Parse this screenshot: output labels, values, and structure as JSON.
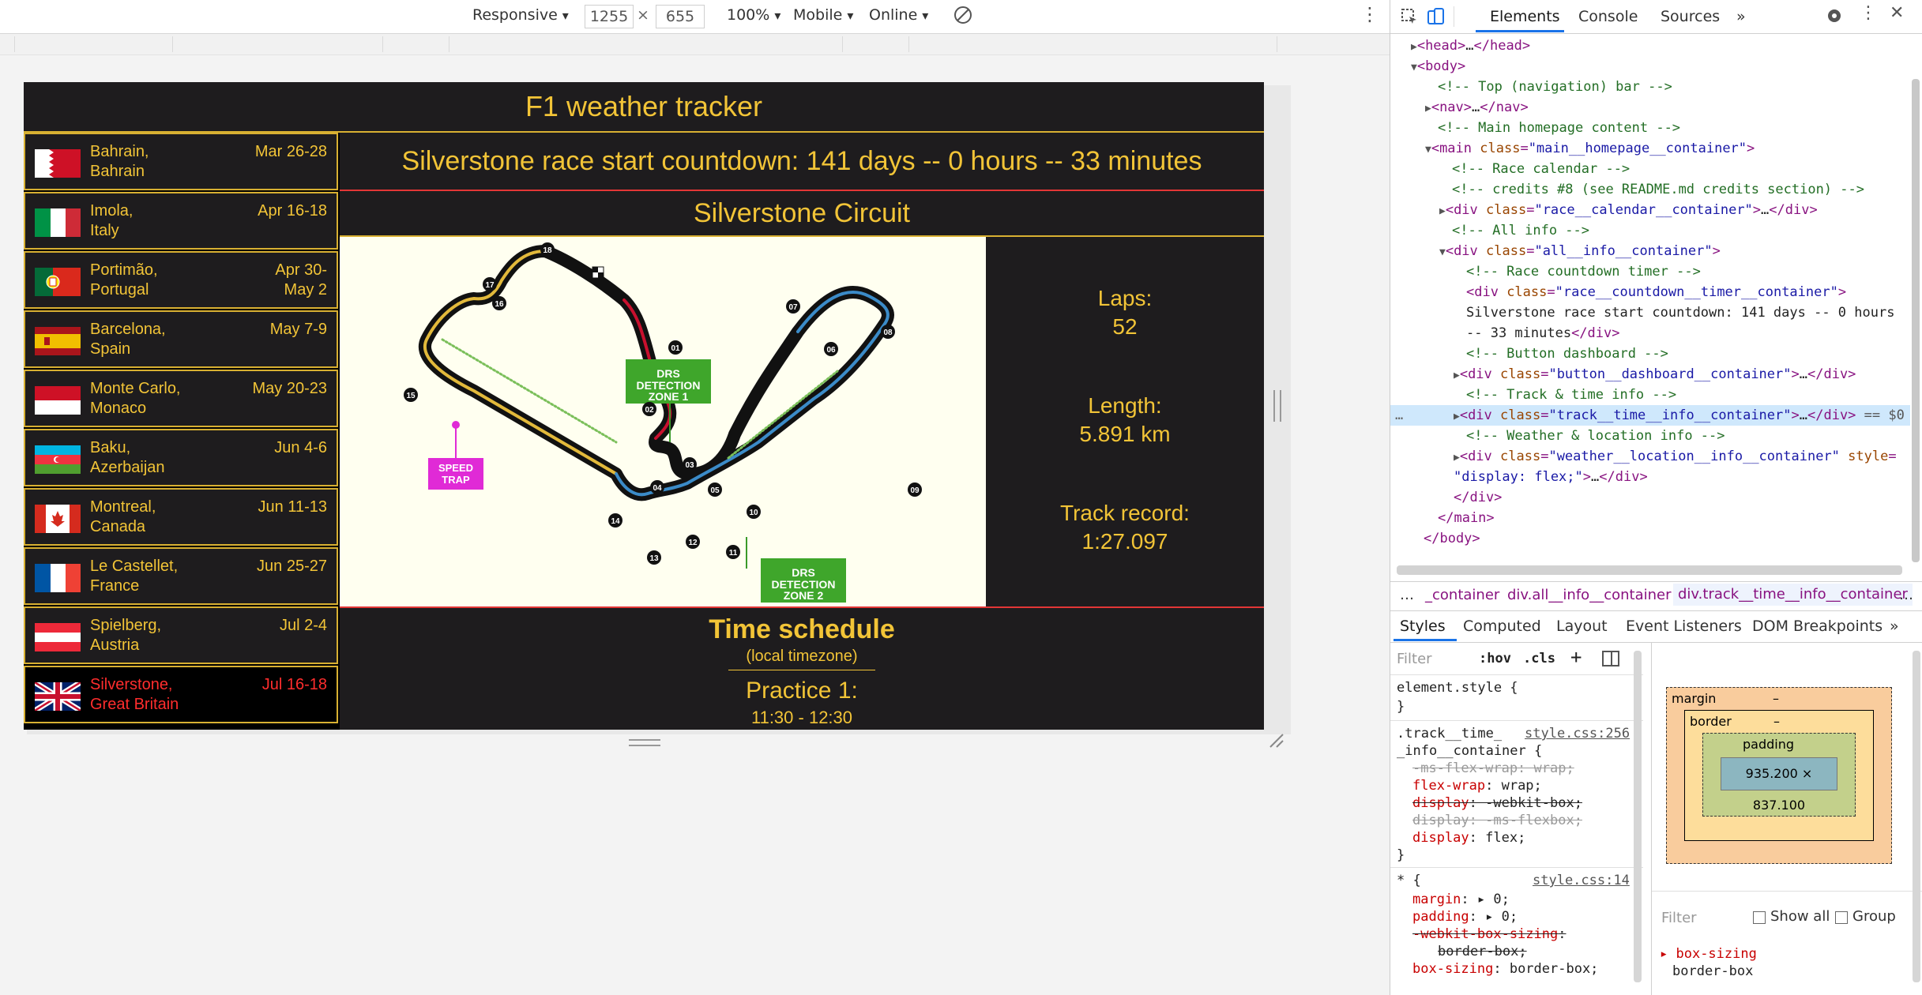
{
  "toolbar": {
    "device": "Responsive",
    "width": "1255",
    "times": "×",
    "height": "655",
    "zoom": "100%",
    "throttle": "Mobile",
    "network": "Online"
  },
  "page": {
    "title": "F1 weather tracker",
    "countdown": "Silverstone race start countdown: 141 days -- 0 hours -- 33 minutes",
    "circuit": "Silverstone Circuit",
    "races": [
      {
        "city": "Bahrain,",
        "country": "Bahrain",
        "date1": "Mar 26-28",
        "date2": ""
      },
      {
        "city": "Imola,",
        "country": "Italy",
        "date1": "Apr 16-18",
        "date2": ""
      },
      {
        "city": "Portimão,",
        "country": "Portugal",
        "date1": "Apr 30-",
        "date2": "May 2"
      },
      {
        "city": "Barcelona,",
        "country": "Spain",
        "date1": "May 7-9",
        "date2": ""
      },
      {
        "city": "Monte Carlo,",
        "country": "Monaco",
        "date1": "May 20-23",
        "date2": ""
      },
      {
        "city": "Baku,",
        "country": "Azerbaijan",
        "date1": "Jun 4-6",
        "date2": ""
      },
      {
        "city": "Montreal,",
        "country": "Canada",
        "date1": "Jun 11-13",
        "date2": ""
      },
      {
        "city": "Le Castellet,",
        "country": "France",
        "date1": "Jun 25-27",
        "date2": ""
      },
      {
        "city": "Spielberg,",
        "country": "Austria",
        "date1": "Jul 2-4",
        "date2": ""
      },
      {
        "city": "Silverstone,",
        "country": "Great Britain",
        "date1": "Jul 16-18",
        "date2": ""
      }
    ],
    "stats": {
      "laps_label": "Laps:",
      "laps_value": "52",
      "length_label": "Length:",
      "length_value": "5.891 km",
      "record_label": "Track record:",
      "record_value": "1:27.097"
    },
    "map_labels": {
      "drs1": [
        "DRS",
        "DETECTION",
        "ZONE 1"
      ],
      "drs2": [
        "DRS",
        "DETECTION",
        "ZONE 2"
      ],
      "speed": [
        "SPEED",
        "TRAP"
      ],
      "turns": [
        "18",
        "17",
        "16",
        "15",
        "01",
        "02",
        "03",
        "04",
        "05",
        "07",
        "06",
        "08",
        "09",
        "10",
        "11",
        "12",
        "13",
        "14"
      ]
    },
    "schedule": {
      "title": "Time schedule",
      "subtitle": "(local timezone)",
      "session": "Practice 1:",
      "time": "11:30 - 12:30"
    }
  },
  "devtools": {
    "tabs": [
      "Elements",
      "Console",
      "Sources",
      "»"
    ],
    "breadcrumb": [
      "…",
      "_container",
      "div.all__info__container",
      "div.track__time__info__container",
      "…"
    ],
    "subtabs": [
      "Styles",
      "Computed",
      "Layout",
      "Event Listeners",
      "DOM Breakpoints",
      "»"
    ],
    "filter_placeholder": "Filter",
    "hov": ":hov",
    "cls": ".cls",
    "box_model": {
      "margin": "margin",
      "border": "border",
      "padding": "padding",
      "content": "935.200 × 837.100",
      "dash": "–"
    },
    "computed_filter": "Filter",
    "show_all": "Show all",
    "group": "Group",
    "computed_prop": "box-sizing",
    "computed_val": "border-box"
  },
  "colors": {
    "gold": "#f2c437",
    "dark": "#1e1c1e",
    "red": "#e33636",
    "accent_blue": "#1a73e8"
  }
}
